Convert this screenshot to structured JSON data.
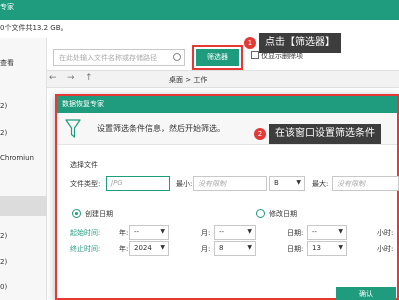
{
  "app": {
    "header_title": "专家",
    "scan_info": "0个文件共13.2 GB。"
  },
  "sidebar": {
    "top_label": "查看",
    "items": [
      {
        "label": "2)"
      },
      {
        "label": "2)"
      },
      {
        "label": "Chromiun"
      },
      {
        "label": "2)"
      },
      {
        "label": "2)"
      },
      {
        "label": "0)"
      },
      {
        "label": "0)"
      }
    ]
  },
  "toolbar": {
    "search_placeholder": "在此处输入文件名称或存储路径",
    "filter_button": "筛选器",
    "only_deleted": "仅显示删除项"
  },
  "breadcrumb": {
    "path": "桌面 > 工作"
  },
  "callouts": {
    "step1": {
      "badge": "1",
      "text": "点击【筛选器】"
    },
    "step2": {
      "badge": "2",
      "text": "在该窗口设置筛选条件"
    }
  },
  "dialog": {
    "title": "数据恢复专家",
    "info": "设置筛选条件信息，然后开始筛选。",
    "section_file": "选择文件",
    "file_type_label": "文件类型:",
    "file_type_placeholder": "JPG",
    "min_label": "最小:",
    "min_placeholder": "没有限制",
    "min_unit": "B",
    "max_label": "最大:",
    "max_placeholder": "没有限制",
    "created_date": "创建日期",
    "modified_date": "修改日期",
    "start_time_label": "起始时间:",
    "end_time_label": "终止时间:",
    "year_label": "年:",
    "month_label": "月:",
    "day_label": "日期:",
    "hour_label": "小时:",
    "start": {
      "year": "--",
      "month": "--",
      "day": "--"
    },
    "end": {
      "year": "2024",
      "month": "8",
      "day": "13"
    },
    "ok_button": "确认",
    "selected_date_mode": "创建日期",
    "accent_color": "#1f9c7e",
    "highlight_color": "#e53935"
  }
}
